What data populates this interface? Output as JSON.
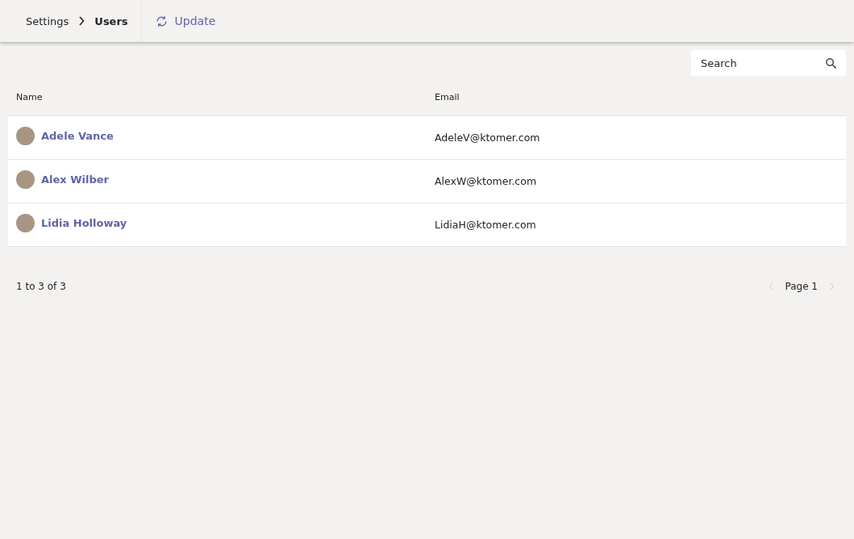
{
  "breadcrumb": [
    {
      "label": "Settings",
      "current": false
    },
    {
      "label": "Users",
      "current": true
    }
  ],
  "toolbar": {
    "update_label": "Update"
  },
  "search": {
    "placeholder": "Search"
  },
  "table": {
    "columns": [
      "Name",
      "Email"
    ],
    "rows": [
      {
        "name": "Adele Vance",
        "email": "AdeleV@ktomer.com"
      },
      {
        "name": "Alex Wilber",
        "email": "AlexW@ktomer.com"
      },
      {
        "name": "Lidia Holloway",
        "email": "LidiaH@ktomer.com"
      }
    ]
  },
  "pagination": {
    "summary": "1 to 3 of 3",
    "page": "Page 1",
    "prev_disabled": true,
    "next_disabled": true
  }
}
